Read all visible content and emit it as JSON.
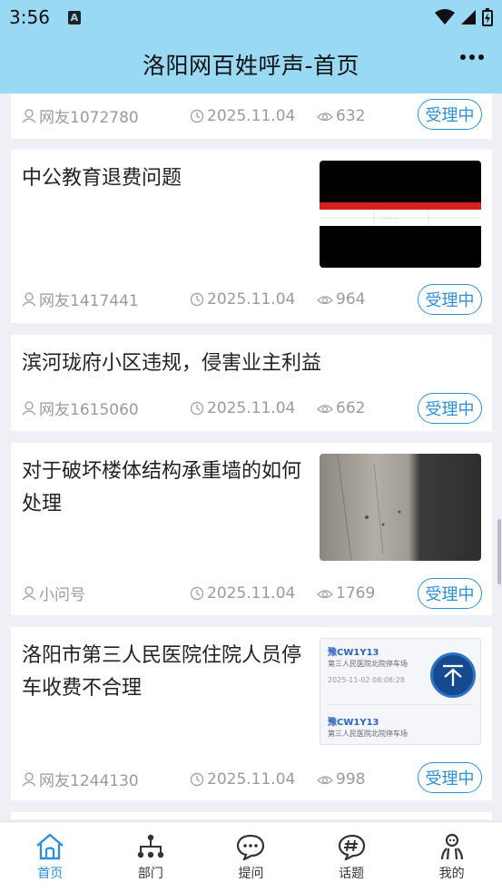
{
  "status_bar": {
    "time": "3:56",
    "notification_glyph": "A"
  },
  "header": {
    "title": "洛阳网百姓呼声-首页",
    "menu_icon": "more-dots-icon"
  },
  "posts": [
    {
      "title": "",
      "user": "网友1072780",
      "date": "2025.11.04",
      "views": "632",
      "status": "受理中"
    },
    {
      "title": "中公教育退费问题",
      "user": "网友1417441",
      "date": "2025.11.04",
      "views": "964",
      "status": "受理中",
      "has_image": true
    },
    {
      "title": "滨河珑府小区违规，侵害业主利益",
      "user": "网友1615060",
      "date": "2025.11.04",
      "views": "662",
      "status": "受理中"
    },
    {
      "title_line1": "对于破坏楼体结构承重墙的如何",
      "title_line2": "处理",
      "user": "小问号",
      "date": "2025.11.04",
      "views": "1769",
      "status": "受理中",
      "has_image": true
    },
    {
      "title_line1": "洛阳市第三人民医院住院人员停",
      "title_line2": "车收费不合理",
      "user": "网友1244130",
      "date": "2025.11.04",
      "views": "998",
      "status": "受理中",
      "has_image": true,
      "image_text": {
        "plate": "豫CW1Y13",
        "place": "第三人民医院北院停车场",
        "time": "2025-11-02 08:08:28",
        "plate2": "豫CW1Y13",
        "place2": "第三人民医院北院停车场"
      }
    }
  ],
  "tabs": [
    {
      "label": "首页",
      "icon": "home-icon",
      "active": true
    },
    {
      "label": "部门",
      "icon": "org-chart-icon"
    },
    {
      "label": "提问",
      "icon": "chat-bubble-icon"
    },
    {
      "label": "话题",
      "icon": "hashtag-bubble-icon"
    },
    {
      "label": "我的",
      "icon": "person-icon"
    }
  ],
  "colors": {
    "header": "#9ad9f3",
    "accent": "#2d8fd6",
    "fab": "#154a8f",
    "meta_text": "#9a9a9a"
  }
}
